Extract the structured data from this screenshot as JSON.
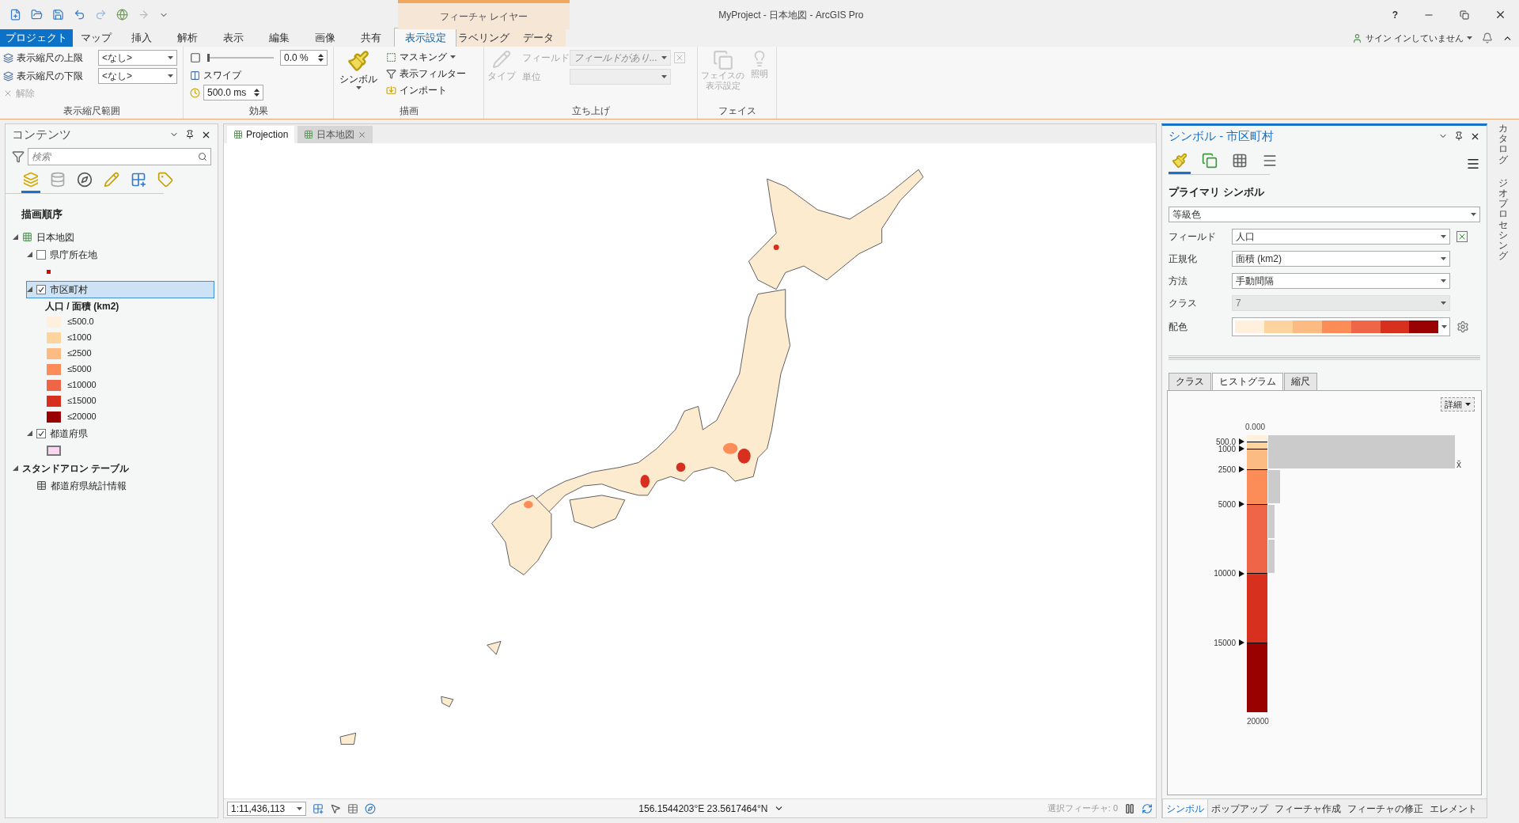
{
  "window": {
    "title": "MyProject - 日本地図 - ArcGIS Pro",
    "help": "?"
  },
  "contextual_group": {
    "label": "フィーチャ レイヤー"
  },
  "tabs": [
    {
      "label": "プロジェクト",
      "kind": "backstage",
      "selected": false
    },
    {
      "label": "マップ",
      "kind": "core",
      "selected": false
    },
    {
      "label": "挿入",
      "kind": "core",
      "selected": false
    },
    {
      "label": "解析",
      "kind": "core",
      "selected": false
    },
    {
      "label": "表示",
      "kind": "core",
      "selected": false
    },
    {
      "label": "編集",
      "kind": "core",
      "selected": false
    },
    {
      "label": "画像",
      "kind": "core",
      "selected": false
    },
    {
      "label": "共有",
      "kind": "core",
      "selected": false
    },
    {
      "label": "表示設定",
      "kind": "contextual",
      "selected": true
    },
    {
      "label": "ラベリング",
      "kind": "contextual",
      "selected": false
    },
    {
      "label": "データ",
      "kind": "contextual",
      "selected": false
    }
  ],
  "sign_in": {
    "label": "サイン インしていません"
  },
  "ribbon": {
    "scale_range": {
      "title": "表示縮尺範囲",
      "upper_label": "表示縮尺の上限",
      "upper_value": "<なし>",
      "lower_label": "表示縮尺の下限",
      "lower_value": "<なし>",
      "clear_label": "解除",
      "clear_disabled": true
    },
    "effects": {
      "title": "効果",
      "transparency_slider": {
        "level": 0
      },
      "transparency_value": "0.0 %",
      "swipe_label": "スワイプ",
      "flicker_value": "500.0 ms"
    },
    "drawing": {
      "title": "描画",
      "symbol_label": "シンボル",
      "masking_label": "マスキング",
      "filter_label": "表示フィルター",
      "import_label": "インポート"
    },
    "extrusion": {
      "title": "立ち上げ",
      "type_label": "タイプ",
      "field_label": "フィールド",
      "field_value": "フィールドがあり...",
      "unit_label": "単位",
      "disabled": true
    },
    "faces": {
      "title": "フェイス",
      "display_label_lines": [
        "フェイスの",
        "表示設定"
      ],
      "lighting_label": "照明",
      "disabled": true
    }
  },
  "contents": {
    "title": "コンテンツ",
    "search_placeholder": "検索",
    "view_tabs": [
      {
        "selected": true
      },
      {
        "selected": false
      },
      {
        "selected": false
      },
      {
        "selected": false
      },
      {
        "selected": false
      },
      {
        "selected": false
      }
    ],
    "heading": "描画順序",
    "tree": [
      {
        "kind": "map",
        "label": "日本地図",
        "expanded": true,
        "children": [
          {
            "kind": "layer",
            "label": "県庁所在地",
            "checked": false,
            "selected": false,
            "expanded": true,
            "symbol": {
              "kind": "point",
              "color": "#e00000"
            }
          },
          {
            "kind": "layer",
            "label": "市区町村",
            "checked": true,
            "selected": true,
            "expanded": true,
            "legend_title": "人口 / 面積 (km2)",
            "classes": [
              {
                "label": "≤500.0",
                "color": "#fef0dc"
              },
              {
                "label": "≤1000",
                "color": "#fdd49e"
              },
              {
                "label": "≤2500",
                "color": "#fdbb84"
              },
              {
                "label": "≤5000",
                "color": "#fc8d59"
              },
              {
                "label": "≤10000",
                "color": "#ef6548"
              },
              {
                "label": "≤15000",
                "color": "#d7301f"
              },
              {
                "label": "≤20000",
                "color": "#990000"
              }
            ]
          },
          {
            "kind": "layer",
            "label": "都道府県",
            "checked": true,
            "selected": false,
            "expanded": true,
            "symbol": {
              "kind": "fill",
              "color": "#fcd6f0"
            }
          }
        ]
      },
      {
        "kind": "group",
        "label": "スタンドアロン テーブル",
        "expanded": true,
        "children": [
          {
            "kind": "table",
            "label": "都道府県統計情報"
          }
        ]
      }
    ]
  },
  "map_tabs": [
    {
      "label": "Projection",
      "selected": false,
      "closable": false
    },
    {
      "label": "日本地図",
      "selected": true,
      "closable": true
    }
  ],
  "status_bar": {
    "scale": "1:11,436,113",
    "coordinates": "156.1544203°E 23.5617464°N",
    "selected_features": "選択フィーチャ: 0"
  },
  "symbology": {
    "title": "シンボル - 市区町村",
    "view_tabs": [
      {
        "selected": true
      },
      {
        "selected": false
      },
      {
        "selected": false
      },
      {
        "selected": false
      }
    ],
    "heading": "プライマリ シンボル",
    "method": "等級色",
    "fields": [
      {
        "kind": "dropdown",
        "label": "フィールド",
        "value": "人口",
        "expression": true,
        "disabled": false
      },
      {
        "kind": "dropdown",
        "label": "正規化",
        "value": "面積 (km2)",
        "disabled": false
      },
      {
        "kind": "dropdown",
        "label": "方法",
        "value": "手動間隔",
        "disabled": false
      },
      {
        "kind": "dropdown",
        "label": "クラス",
        "value": "7",
        "disabled": true
      },
      {
        "kind": "ramp",
        "label": "配色",
        "disabled": false
      }
    ],
    "color_ramp": [
      {
        "color": "#fef0dc"
      },
      {
        "color": "#fdd49e"
      },
      {
        "color": "#fdbb84"
      },
      {
        "color": "#fc8d59"
      },
      {
        "color": "#ef6548"
      },
      {
        "color": "#d7301f"
      },
      {
        "color": "#990000"
      }
    ],
    "sub_tabs": [
      {
        "label": "クラス",
        "selected": false
      },
      {
        "label": "ヒストグラム",
        "selected": true
      },
      {
        "label": "縮尺",
        "selected": false
      }
    ],
    "histogram": {
      "detail_button": "詳細",
      "top_label": "0.000",
      "bottom_label": "20000",
      "mean_label": "x̄",
      "breaks": [
        "500.0",
        "1000",
        "2500",
        "5000",
        "10000",
        "15000"
      ]
    },
    "bottom_tabs": [
      {
        "label": "シンボル",
        "selected": true
      },
      {
        "label": "ポップアップ",
        "selected": false
      },
      {
        "label": "フィーチャ作成",
        "selected": false
      },
      {
        "label": "フィーチャの修正",
        "selected": false
      },
      {
        "label": "エレメント",
        "selected": false
      }
    ]
  },
  "side_tabs": [
    {
      "label": "カタログ"
    },
    {
      "label": "ジオプロセシング"
    }
  ]
}
